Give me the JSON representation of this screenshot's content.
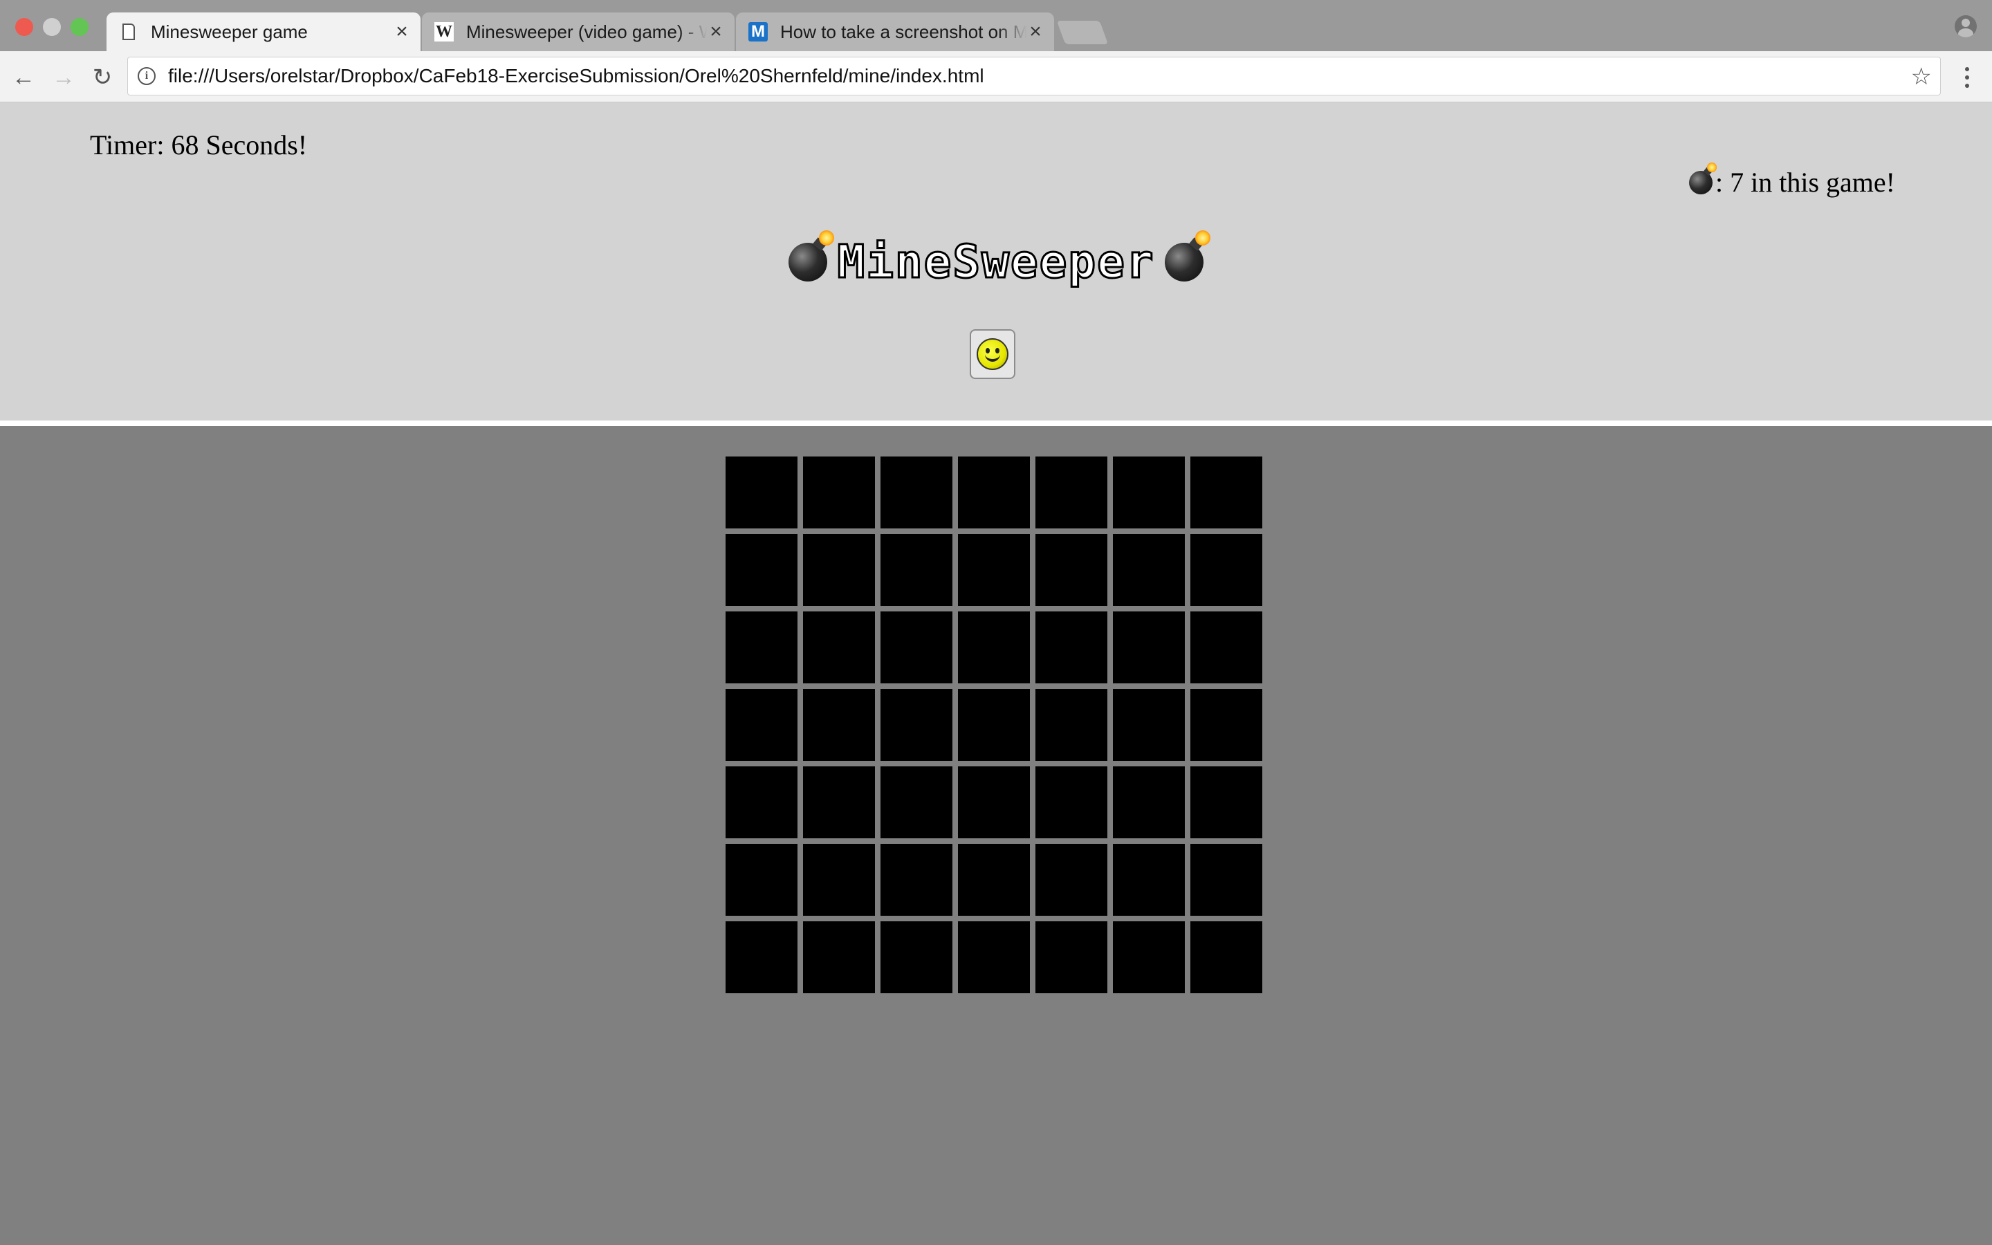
{
  "browser": {
    "tabs": [
      {
        "title": "Minesweeper game",
        "icon": "page-icon",
        "active": true
      },
      {
        "title": "Minesweeper (video game) - W",
        "icon": "wikipedia-icon",
        "icon_glyph": "W",
        "active": false
      },
      {
        "title": "How to take a screenshot on M",
        "icon": "m-site-icon",
        "icon_glyph": "M",
        "active": false
      }
    ],
    "url": "file:///Users/orelstar/Dropbox/CaFeb18-ExerciseSubmission/Orel%20Shernfeld/mine/index.html",
    "close_glyph": "×",
    "back_glyph": "←",
    "forward_glyph": "→",
    "reload_glyph": "↻",
    "star_glyph": "☆",
    "info_glyph": "i"
  },
  "game": {
    "timer_text": "Timer: 68 Seconds!",
    "mines_text": ": 7 in this game!",
    "title": "MineSweeper",
    "board": {
      "rows": 7,
      "cols": 7,
      "cell_state": "hidden"
    }
  },
  "colors": {
    "header_bg": "#d3d3d3",
    "body_bg": "#808080",
    "cell_hidden": "#000000"
  }
}
